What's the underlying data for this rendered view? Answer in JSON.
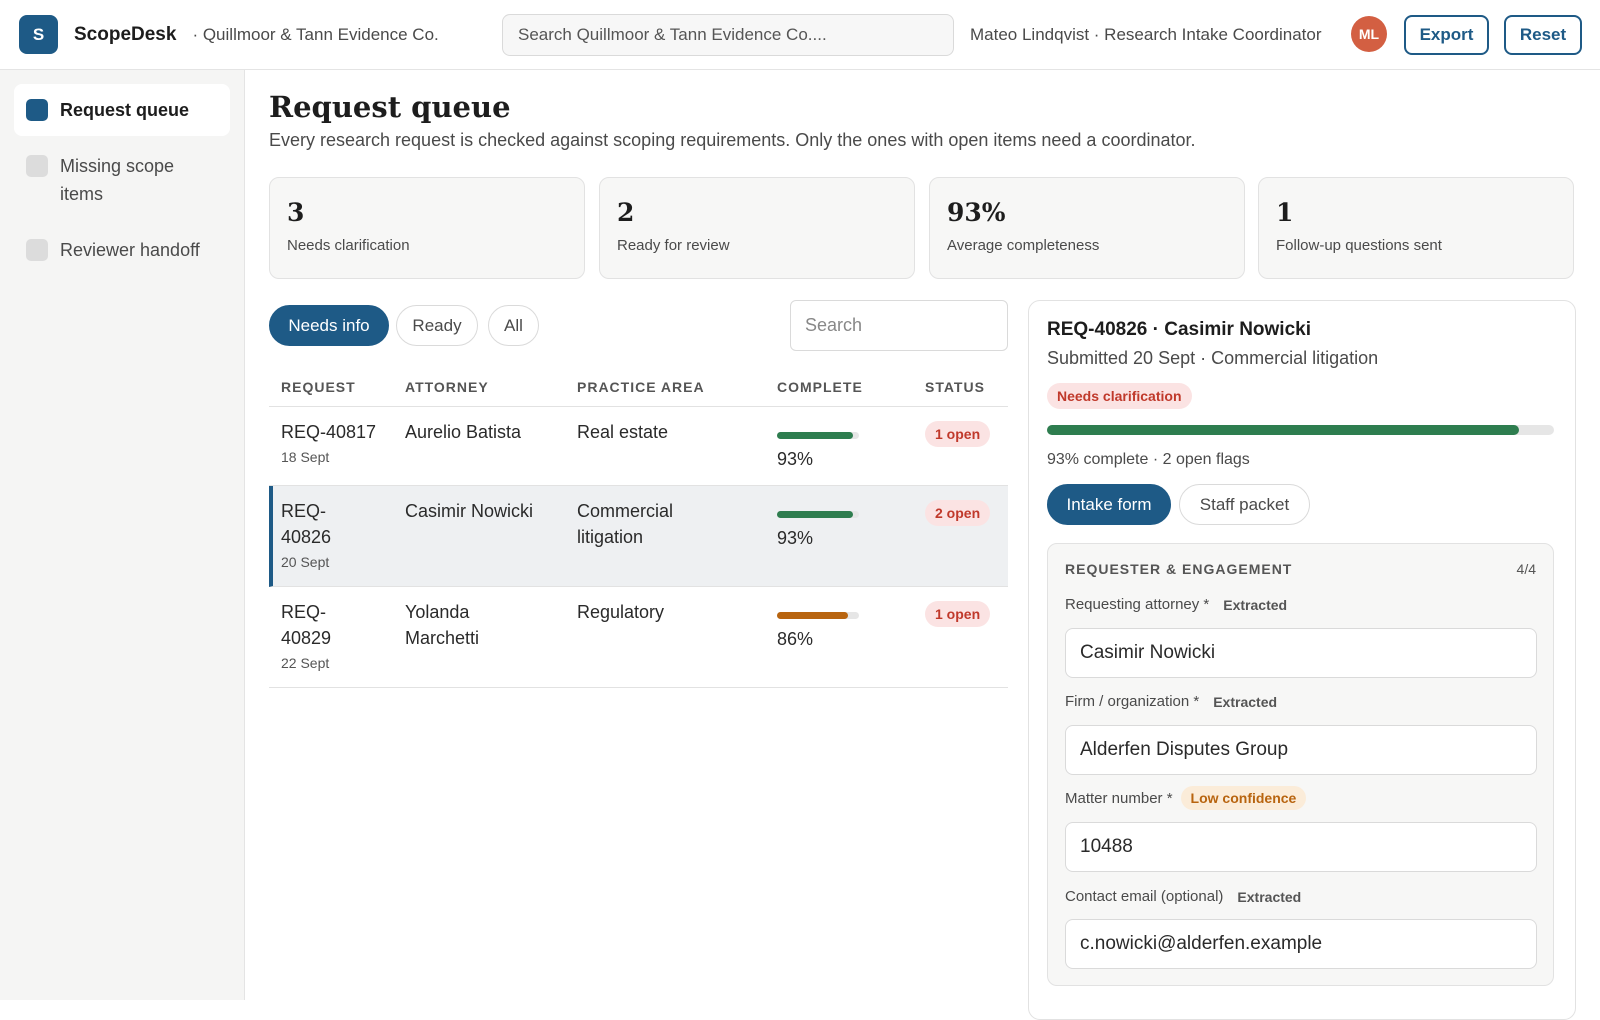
{
  "app": {
    "logo_letter": "S",
    "name": "ScopeDesk",
    "org": "· Quillmoor & Tann Evidence Co.",
    "search_placeholder": "Search Quillmoor & Tann Evidence Co....",
    "user": "Mateo Lindqvist · Research Intake Coordinator",
    "avatar_initials": "ML",
    "export_label": "Export",
    "reset_label": "Reset"
  },
  "sidebar": {
    "items": [
      {
        "label": "Request queue",
        "active": true
      },
      {
        "label": "Missing scope items",
        "active": false
      },
      {
        "label": "Reviewer handoff",
        "active": false
      }
    ]
  },
  "page": {
    "title": "Request queue",
    "subtitle": "Every research request is checked against scoping requirements. Only the ones with open items need a coordinator."
  },
  "stats": [
    {
      "value": "3",
      "label": "Needs clarification"
    },
    {
      "value": "2",
      "label": "Ready for review"
    },
    {
      "value": "93%",
      "label": "Average completeness"
    },
    {
      "value": "1",
      "label": "Follow-up questions sent"
    }
  ],
  "filters": {
    "chips": [
      "Needs info",
      "Ready",
      "All"
    ],
    "active": "Needs info",
    "search_placeholder": "Search"
  },
  "table": {
    "columns": [
      "REQUEST",
      "ATTORNEY",
      "PRACTICE AREA",
      "COMPLETE",
      "STATUS"
    ],
    "rows": [
      {
        "id": "REQ-40817",
        "date": "18 Sept",
        "attorney": "Aurelio Batista",
        "area": "Real estate",
        "complete": 93,
        "complete_label": "93%",
        "status": "1 open",
        "bar_color": "#2e7d4f",
        "selected": false
      },
      {
        "id": "REQ-40826",
        "date": "20 Sept",
        "attorney": "Casimir Nowicki",
        "area": "Commercial litigation",
        "complete": 93,
        "complete_label": "93%",
        "status": "2 open",
        "bar_color": "#2e7d4f",
        "selected": true
      },
      {
        "id": "REQ-40829",
        "date": "22 Sept",
        "attorney": "Yolanda Marchetti",
        "area": "Regulatory",
        "complete": 86,
        "complete_label": "86%",
        "status": "1 open",
        "bar_color": "#b8640f",
        "selected": false
      }
    ]
  },
  "detail": {
    "title": "REQ-40826 · Casimir Nowicki",
    "subtitle": "Submitted 20 Sept · Commercial litigation",
    "badge": "Needs clarification",
    "progress": 0.93,
    "meta": "93% complete · 2 open flags",
    "tabs": [
      "Intake form",
      "Staff packet"
    ],
    "active_tab": "Intake form",
    "section": {
      "heading": "REQUESTER & ENGAGEMENT",
      "count": "4/4",
      "fields": [
        {
          "label": "Requesting attorney *",
          "tag": "Extracted",
          "tag_type": "extracted",
          "value": "Casimir Nowicki"
        },
        {
          "label": "Firm / organization *",
          "tag": "Extracted",
          "tag_type": "extracted",
          "value": "Alderfen Disputes Group"
        },
        {
          "label": "Matter number *",
          "tag": "Low confidence",
          "tag_type": "low",
          "value": "10488"
        },
        {
          "label": "Contact email (optional)",
          "tag": "Extracted",
          "tag_type": "extracted",
          "value": "c.nowicki@alderfen.example"
        }
      ]
    }
  },
  "colors": {
    "accent": "#1e5a86",
    "success": "#2e7d4f",
    "warning": "#b8640f",
    "danger": "#c0392b",
    "avatar": "#d35f42"
  }
}
